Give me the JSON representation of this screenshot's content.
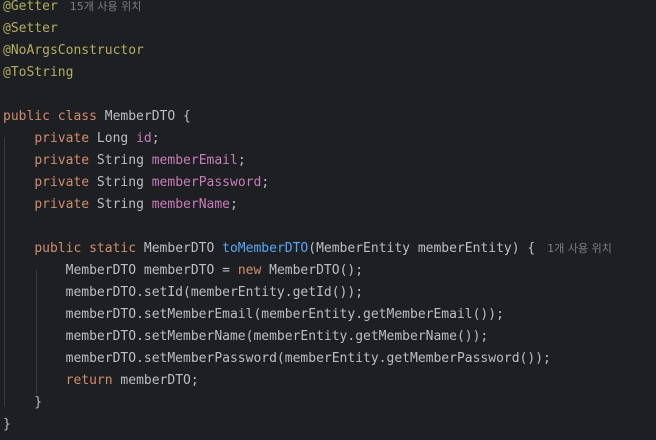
{
  "editor": {
    "language": "java",
    "colors": {
      "background": "#1e1f22",
      "annotation": "#b3ae60",
      "keyword": "#cf8e6d",
      "field": "#c77dbb",
      "method_declaration": "#56a8f5",
      "text": "#bcbec4",
      "inlay_hint": "#7a7e85"
    },
    "lines": [
      {
        "tokens": [
          {
            "t": "@Getter",
            "c": "ann"
          }
        ],
        "hint": "15개 사용 위치"
      },
      {
        "tokens": [
          {
            "t": "@Setter",
            "c": "ann"
          }
        ]
      },
      {
        "tokens": [
          {
            "t": "@NoArgsConstructor",
            "c": "ann"
          }
        ]
      },
      {
        "tokens": [
          {
            "t": "@ToString",
            "c": "ann"
          }
        ]
      },
      {
        "tokens": []
      },
      {
        "tokens": [
          {
            "t": "public class",
            "c": "kw"
          },
          {
            "t": " MemberDTO {",
            "c": "txt"
          }
        ]
      },
      {
        "tokens": [
          {
            "t": "    "
          },
          {
            "t": "private",
            "c": "kw"
          },
          {
            "t": " Long ",
            "c": "typ"
          },
          {
            "t": "id",
            "c": "fld"
          },
          {
            "t": ";",
            "c": "txt"
          }
        ]
      },
      {
        "tokens": [
          {
            "t": "    "
          },
          {
            "t": "private",
            "c": "kw"
          },
          {
            "t": " String ",
            "c": "typ"
          },
          {
            "t": "memberEmail",
            "c": "fld"
          },
          {
            "t": ";",
            "c": "txt"
          }
        ]
      },
      {
        "tokens": [
          {
            "t": "    "
          },
          {
            "t": "private",
            "c": "kw"
          },
          {
            "t": " String ",
            "c": "typ"
          },
          {
            "t": "memberPassword",
            "c": "fld"
          },
          {
            "t": ";",
            "c": "txt"
          }
        ]
      },
      {
        "tokens": [
          {
            "t": "    "
          },
          {
            "t": "private",
            "c": "kw"
          },
          {
            "t": " String ",
            "c": "typ"
          },
          {
            "t": "memberName",
            "c": "fld"
          },
          {
            "t": ";",
            "c": "txt"
          }
        ]
      },
      {
        "tokens": []
      },
      {
        "tokens": [
          {
            "t": "    "
          },
          {
            "t": "public static",
            "c": "kw"
          },
          {
            "t": " MemberDTO ",
            "c": "typ"
          },
          {
            "t": "toMemberDTO",
            "c": "fn"
          },
          {
            "t": "(MemberEntity memberEntity) {",
            "c": "txt"
          }
        ],
        "hint": "1개 사용 위치"
      },
      {
        "tokens": [
          {
            "t": "        MemberDTO memberDTO = ",
            "c": "txt"
          },
          {
            "t": "new",
            "c": "kw"
          },
          {
            "t": " MemberDTO();",
            "c": "txt"
          }
        ]
      },
      {
        "tokens": [
          {
            "t": "        memberDTO.setId(memberEntity.getId());",
            "c": "txt"
          }
        ]
      },
      {
        "tokens": [
          {
            "t": "        memberDTO.setMemberEmail(memberEntity.getMemberEmail());",
            "c": "txt"
          }
        ]
      },
      {
        "tokens": [
          {
            "t": "        memberDTO.setMemberName(memberEntity.getMemberName());",
            "c": "txt"
          }
        ]
      },
      {
        "tokens": [
          {
            "t": "        memberDTO.setMemberPassword(memberEntity.getMemberPassword());",
            "c": "txt"
          }
        ]
      },
      {
        "tokens": [
          {
            "t": "        "
          },
          {
            "t": "return",
            "c": "kw"
          },
          {
            "t": " memberDTO;",
            "c": "txt"
          }
        ]
      },
      {
        "tokens": [
          {
            "t": "    }",
            "c": "txt"
          }
        ]
      },
      {
        "tokens": [
          {
            "t": "}",
            "c": "txt"
          }
        ]
      }
    ]
  }
}
